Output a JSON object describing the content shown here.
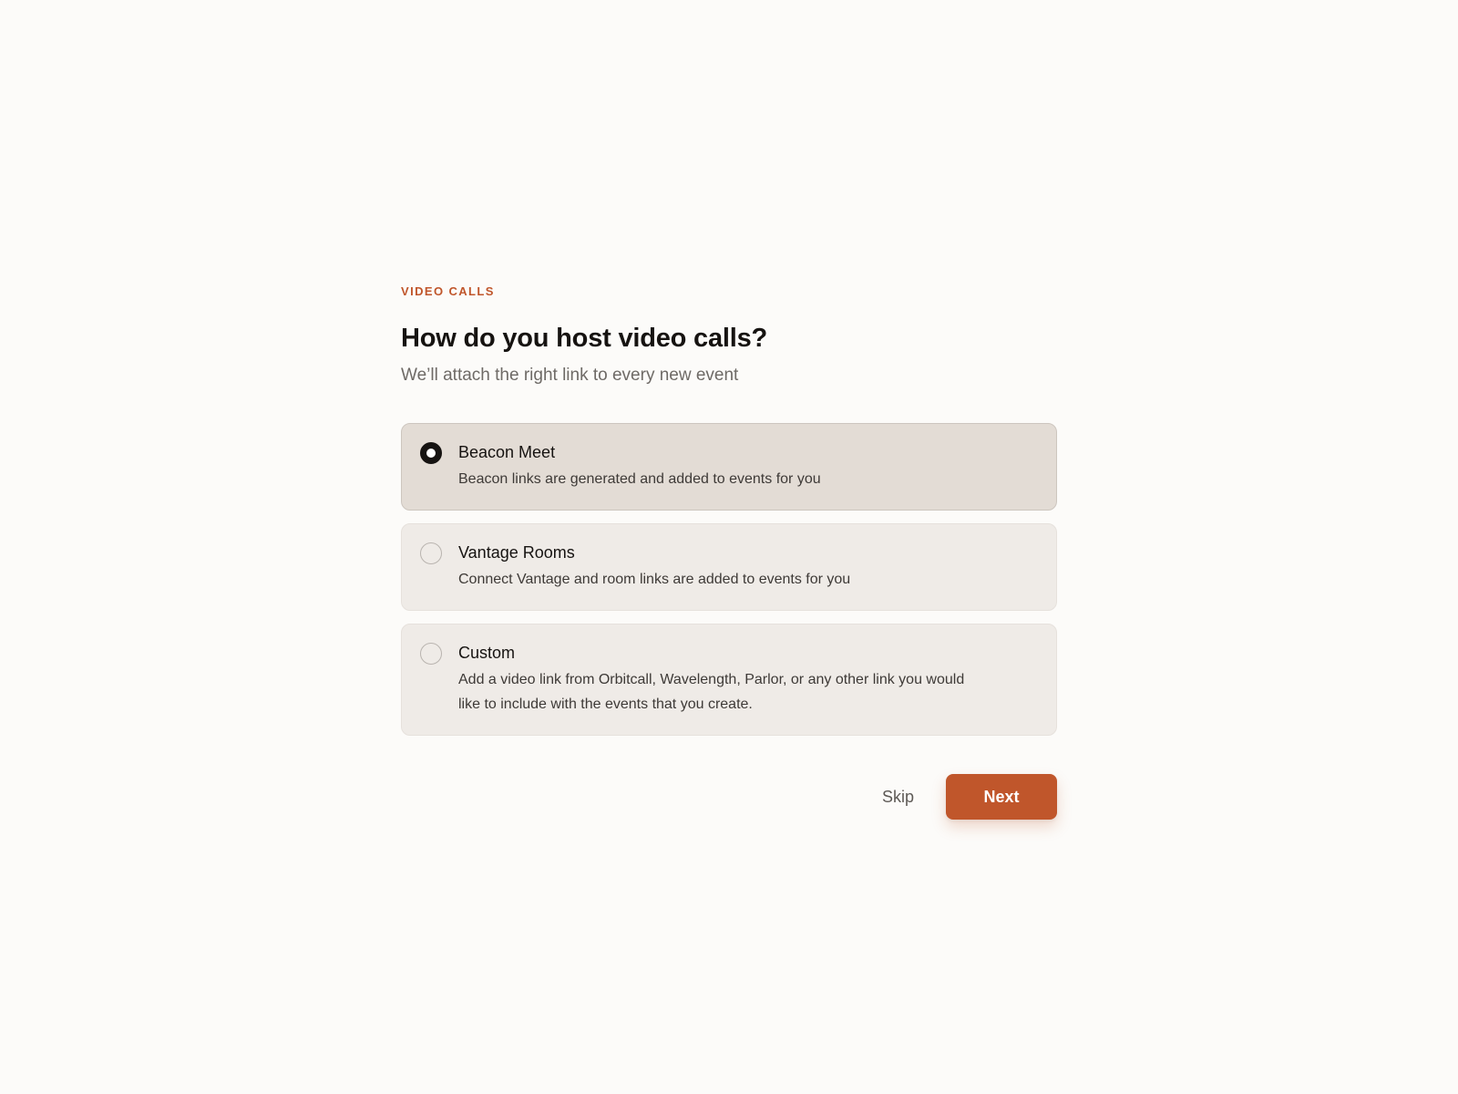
{
  "header": {
    "eyebrow": "VIDEO CALLS",
    "title": "How do you host video calls?",
    "subtitle": "We’ll attach the right link to every new event"
  },
  "options": [
    {
      "title": "Beacon Meet",
      "description": "Beacon links are generated and added to events for you",
      "selected": true
    },
    {
      "title": "Vantage Rooms",
      "description": "Connect Vantage and room links are added to events for you",
      "selected": false
    },
    {
      "title": "Custom",
      "description": "Add a video link from Orbitcall, Wavelength, Parlor, or any other link you would like to include with the events that you create.",
      "selected": false
    }
  ],
  "actions": {
    "skip_label": "Skip",
    "next_label": "Next"
  },
  "colors": {
    "accent": "#c0562b",
    "background": "#fcfbf9",
    "option_bg": "#efebe7",
    "option_selected_bg": "#e3dcd5"
  }
}
